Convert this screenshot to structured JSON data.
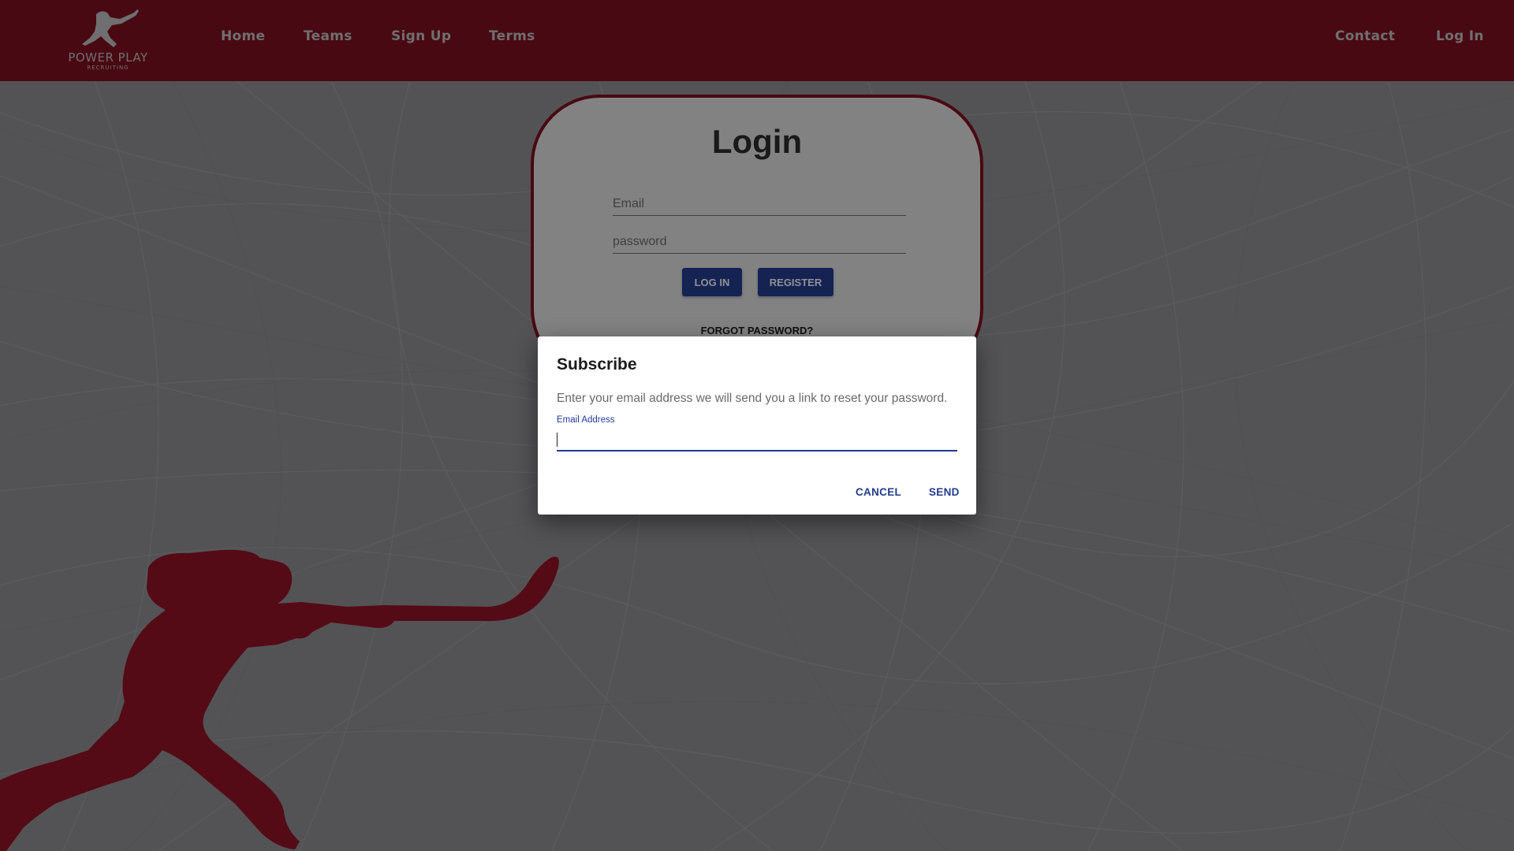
{
  "brand": {
    "name": "POWER PLAY",
    "tagline": "RECRUITING",
    "primary_color": "#7a0f1e",
    "accent_color": "#233b8b"
  },
  "nav": {
    "left": [
      "Home",
      "Teams",
      "Sign Up",
      "Terms"
    ],
    "right": [
      "Contact",
      "Log In"
    ]
  },
  "login": {
    "title": "Login",
    "email_placeholder": "Email",
    "password_placeholder": "password",
    "login_button": "LOG IN",
    "register_button": "REGISTER",
    "forgot_link": "FORGOT PASSWORD?"
  },
  "dialog": {
    "title": "Subscribe",
    "text": "Enter your email address we will send you a link to reset your password.",
    "field_label": "Email Address",
    "field_value": "",
    "cancel_label": "CANCEL",
    "send_label": "SEND"
  },
  "icons": {
    "logo": "hockey-player-logo-icon",
    "background_figure": "hockey-player-silhouette"
  }
}
